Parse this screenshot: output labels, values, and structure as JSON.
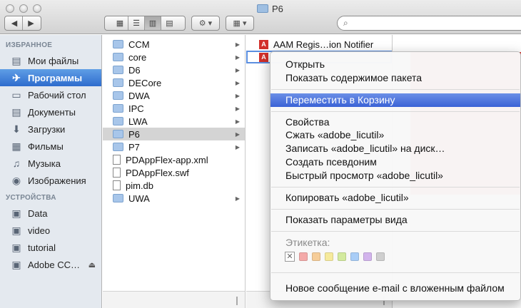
{
  "window": {
    "title": "P6"
  },
  "sidebar": {
    "favorites_header": "ИЗБРАННОЕ",
    "favorites": [
      {
        "label": "Мои файлы",
        "icon": "all-my-files-icon"
      },
      {
        "label": "Программы",
        "icon": "applications-icon"
      },
      {
        "label": "Рабочий стол",
        "icon": "desktop-icon"
      },
      {
        "label": "Документы",
        "icon": "documents-icon"
      },
      {
        "label": "Загрузки",
        "icon": "downloads-icon"
      },
      {
        "label": "Фильмы",
        "icon": "movies-icon"
      },
      {
        "label": "Музыка",
        "icon": "music-icon"
      },
      {
        "label": "Изображения",
        "icon": "pictures-icon"
      }
    ],
    "devices_header": "УСТРОЙСТВА",
    "devices": [
      {
        "label": "Data",
        "icon": "disk-icon"
      },
      {
        "label": "video",
        "icon": "disk-icon"
      },
      {
        "label": "tutorial",
        "icon": "disk-icon"
      },
      {
        "label": "Adobe CC…",
        "icon": "disk-icon"
      }
    ]
  },
  "column1": {
    "items": [
      {
        "label": "CCM",
        "type": "folder"
      },
      {
        "label": "core",
        "type": "folder"
      },
      {
        "label": "D6",
        "type": "folder"
      },
      {
        "label": "DECore",
        "type": "folder"
      },
      {
        "label": "DWA",
        "type": "folder"
      },
      {
        "label": "IPC",
        "type": "folder"
      },
      {
        "label": "LWA",
        "type": "folder"
      },
      {
        "label": "P6",
        "type": "folder"
      },
      {
        "label": "P7",
        "type": "folder"
      },
      {
        "label": "PDAppFlex-app.xml",
        "type": "file"
      },
      {
        "label": "PDAppFlex.swf",
        "type": "file"
      },
      {
        "label": "pim.db",
        "type": "file"
      },
      {
        "label": "UWA",
        "type": "folder"
      }
    ]
  },
  "column2": {
    "first_item": "AAM Regis…ion Notifier"
  },
  "context_menu": {
    "open": "Открыть",
    "show_package": "Показать содержимое пакета",
    "move_to_trash": "Переместить в Корзину",
    "get_info": "Свойства",
    "compress": "Сжать «adobe_licutil»",
    "burn": "Записать «adobe_licutil» на диск…",
    "make_alias": "Создать псевдоним",
    "quick_look": "Быстрый просмотр «adobe_licutil»",
    "copy": "Копировать «adobe_licutil»",
    "view_options": "Показать параметры вида",
    "label_title": "Этикетка:",
    "label_colors": [
      "#f4aaa9",
      "#f6cd99",
      "#f6ea9c",
      "#d3ea9e",
      "#a9cdf7",
      "#d2b4ec",
      "#cfcfcf"
    ],
    "new_email": "Новое сообщение e-mail с вложенным файлом"
  },
  "colors": {
    "selection": "#3a62d6",
    "sidebar_bg": "#e4e9ef",
    "adobe_red": "#d6251d"
  }
}
